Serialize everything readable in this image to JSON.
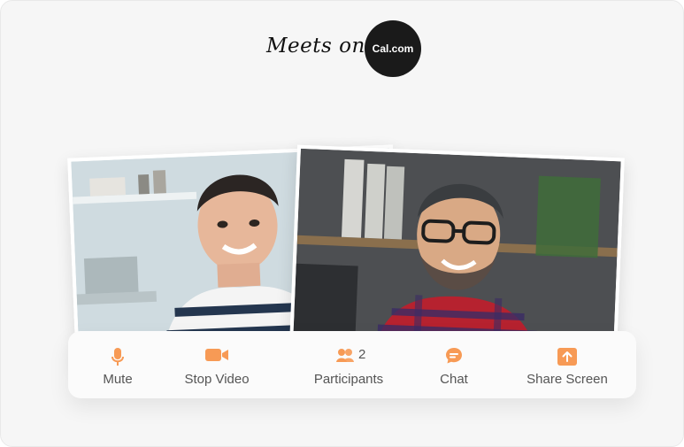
{
  "header": {
    "text": "Meets on",
    "logo_text": "Cal.com"
  },
  "toolbar": {
    "accent": "#f79a55",
    "mute": {
      "label": "Mute",
      "icon": "microphone-icon"
    },
    "stop_video": {
      "label": "Stop Video",
      "icon": "video-camera-icon"
    },
    "participants": {
      "label": "Participants",
      "count": "2",
      "icon": "people-icon"
    },
    "chat": {
      "label": "Chat",
      "icon": "chat-bubble-icon"
    },
    "share_screen": {
      "label": "Share Screen",
      "icon": "upload-arrow-icon"
    }
  }
}
